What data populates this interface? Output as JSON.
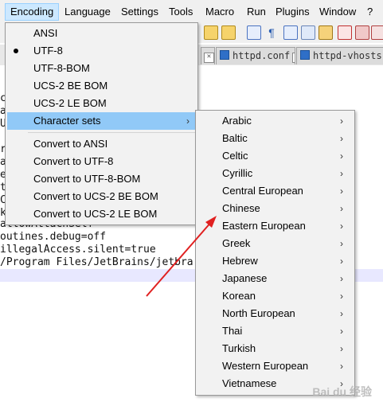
{
  "menubar": {
    "items": [
      "Encoding",
      "Language",
      "Settings",
      "Tools",
      "Macro",
      "Run",
      "Plugins",
      "Window",
      "?"
    ]
  },
  "tabs": [
    {
      "label": "httpd.conf"
    },
    {
      "label": "httpd-vhosts.co"
    }
  ],
  "editor": {
    "lines": [
      "c",
      "a",
      "U",
      "r",
      "a",
      "e",
      "t",
      "C",
      "k",
      "allowAttachSelf",
      "outines.debug=off",
      "illegalAccess.silent=true",
      "/Program Files/JetBrains/jetbra"
    ]
  },
  "encoding_menu": {
    "items": [
      {
        "label": "ANSI",
        "selected": false,
        "submenu": false
      },
      {
        "label": "UTF-8",
        "selected": true,
        "submenu": false
      },
      {
        "label": "UTF-8-BOM",
        "selected": false,
        "submenu": false
      },
      {
        "label": "UCS-2 BE BOM",
        "selected": false,
        "submenu": false
      },
      {
        "label": "UCS-2 LE BOM",
        "selected": false,
        "submenu": false
      },
      {
        "label": "Character sets",
        "selected": false,
        "submenu": true,
        "highlighted": true
      },
      {
        "label": "Convert to ANSI",
        "selected": false,
        "submenu": false
      },
      {
        "label": "Convert to UTF-8",
        "selected": false,
        "submenu": false
      },
      {
        "label": "Convert to UTF-8-BOM",
        "selected": false,
        "submenu": false
      },
      {
        "label": "Convert to UCS-2 BE BOM",
        "selected": false,
        "submenu": false
      },
      {
        "label": "Convert to UCS-2 LE BOM",
        "selected": false,
        "submenu": false
      }
    ]
  },
  "charsets_submenu": {
    "items": [
      "Arabic",
      "Baltic",
      "Celtic",
      "Cyrillic",
      "Central European",
      "Chinese",
      "Eastern European",
      "Greek",
      "Hebrew",
      "Japanese",
      "Korean",
      "North European",
      "Thai",
      "Turkish",
      "Western European",
      "Vietnamese"
    ]
  },
  "watermark": "Bai du 经验",
  "icons": {
    "submenu_arrow": "chevron-right-icon",
    "selected_marker": "bullet-icon",
    "annotation": "red-arrow"
  },
  "colors": {
    "menu_highlight": "#91c9f7",
    "menubar_active": "#cce8ff",
    "annotation_arrow": "#e02020"
  }
}
